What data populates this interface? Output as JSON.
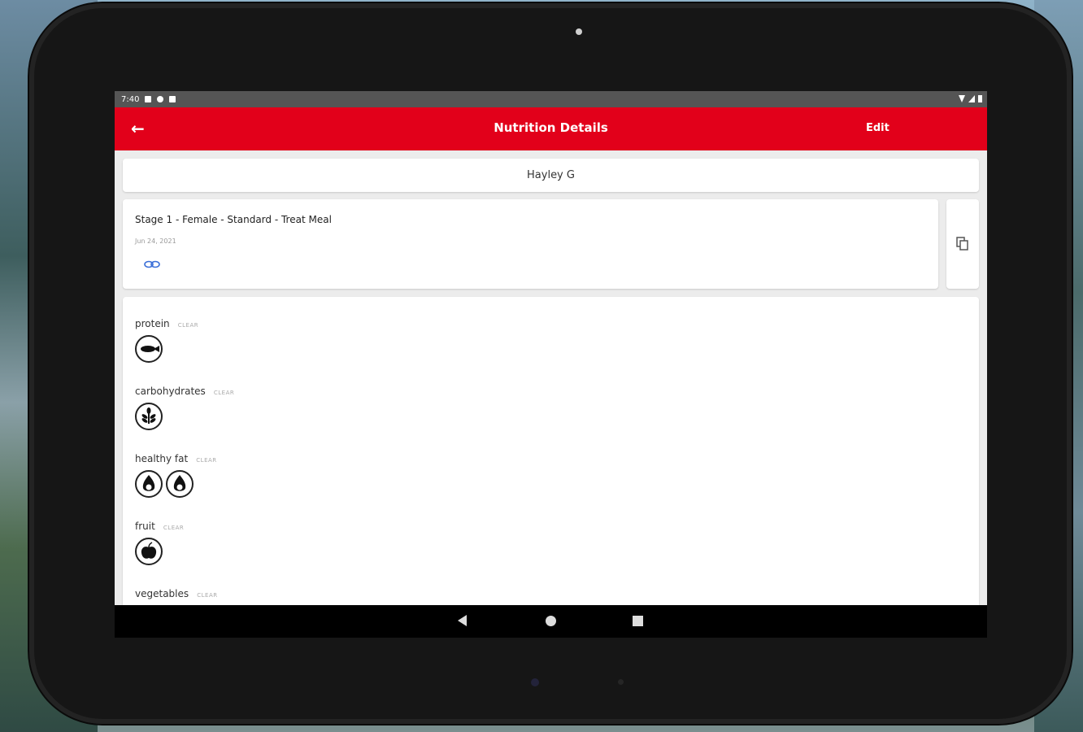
{
  "status": {
    "time": "7:40"
  },
  "app_bar": {
    "title": "Nutrition Details",
    "edit_label": "Edit"
  },
  "client": {
    "name": "Hayley G"
  },
  "meal": {
    "title": "Stage 1 - Female - Standard - Treat Meal",
    "date": "Jun 24, 2021"
  },
  "categories": [
    {
      "label": "protein",
      "clear_label": "CLEAR",
      "icons": [
        "fish-icon"
      ]
    },
    {
      "label": "carbohydrates",
      "clear_label": "CLEAR",
      "icons": [
        "grain-icon"
      ]
    },
    {
      "label": "healthy fat",
      "clear_label": "CLEAR",
      "icons": [
        "avocado-icon",
        "avocado-icon"
      ]
    },
    {
      "label": "fruit",
      "clear_label": "CLEAR",
      "icons": [
        "apple-icon"
      ]
    },
    {
      "label": "vegetables",
      "clear_label": "CLEAR",
      "icons": []
    }
  ],
  "colors": {
    "brand": "#e2001a",
    "link": "#3b6fd8"
  }
}
